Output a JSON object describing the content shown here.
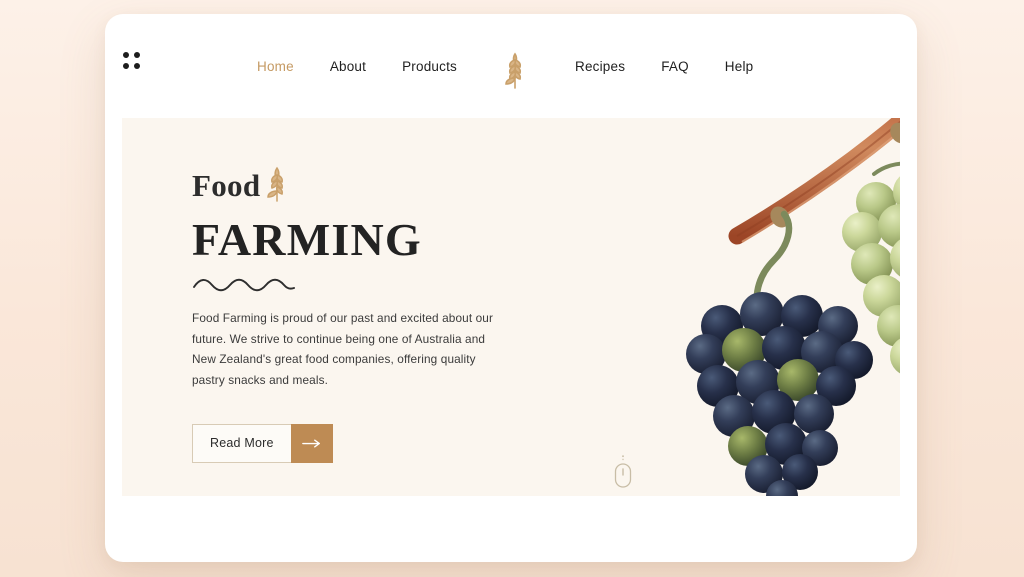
{
  "theme": {
    "page_background": "#fbe9dc",
    "card_background": "#ffffff",
    "hero_background": "#fbf6ef",
    "accent_tan": "#c59a63",
    "button_fill": "#be8b54",
    "text_dark": "#232323",
    "body_text": "#3b3b3b",
    "wheat_icon_color": "#c9a06a"
  },
  "nav": {
    "menu_icon": "grid-dots-icon",
    "logo_icon": "wheat-icon",
    "left_links": [
      {
        "label": "Home",
        "active": true
      },
      {
        "label": "About",
        "active": false
      },
      {
        "label": "Products",
        "active": false
      }
    ],
    "right_links": [
      {
        "label": "Recipes",
        "active": false
      },
      {
        "label": "FAQ",
        "active": false
      },
      {
        "label": "Help",
        "active": false
      }
    ]
  },
  "hero": {
    "eyebrow": "Food",
    "eyebrow_icon": "wheat-icon",
    "title": "FARMING",
    "divider_icon": "wavy-line-divider",
    "paragraph": "Food Farming is proud of our past and excited about our future. We strive to continue being one of Australia and New Zealand's great food companies, offering quality pastry snacks and meals.",
    "cta": {
      "label": "Read More",
      "arrow_icon": "arrow-right-icon"
    },
    "scroll_indicator_icon": "mouse-scroll-icon",
    "artwork": {
      "name": "grape-bunches-illustration",
      "description": "Two hanging grape bunches on a brown vine branch",
      "dark_bunch_color": "#2b3247",
      "light_bunch_color": "#bcc98a",
      "branch_color": "#b5603a"
    }
  }
}
